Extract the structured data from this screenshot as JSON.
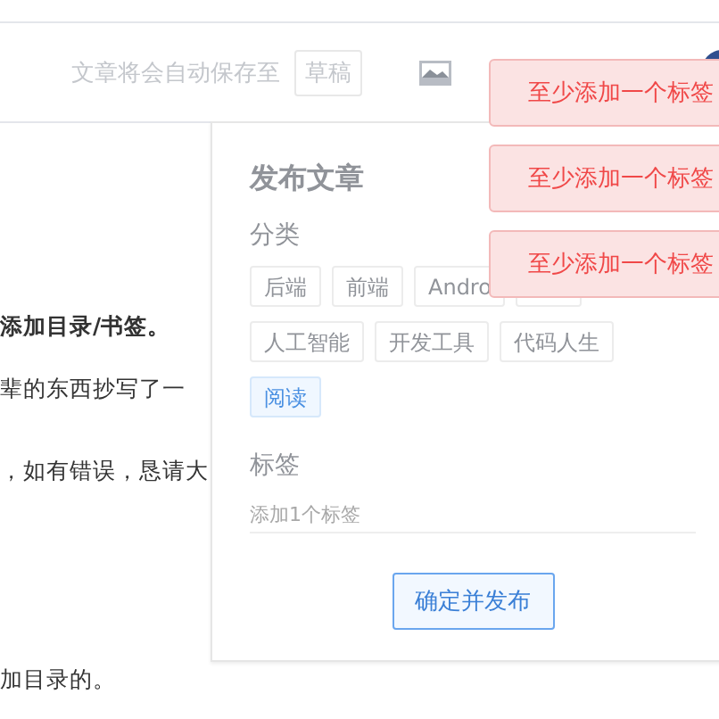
{
  "header": {
    "autosave_note": "文章将会自动保存至",
    "draft_button": "草稿"
  },
  "article": {
    "paragraphs": [
      {
        "text": "添加目录/书签。",
        "kind": "bold"
      },
      {
        "text": "辈的东西抄写了一",
        "kind": "plain"
      },
      {
        "text": "，如有错误，恳请大",
        "kind": "plain"
      },
      {
        "text": "加目录的。",
        "kind": "plain"
      }
    ]
  },
  "publish_panel": {
    "title": "发布文章",
    "category_label": "分类",
    "categories": [
      {
        "label": "后端",
        "selected": false
      },
      {
        "label": "前端",
        "selected": false
      },
      {
        "label": "Andro",
        "selected": false
      },
      {
        "selected": false
      },
      {
        "label": "人工智能",
        "selected": false
      },
      {
        "label": "开发工具",
        "selected": false
      },
      {
        "label": "代码人生",
        "selected": false
      },
      {
        "label": "阅读",
        "selected": true
      }
    ],
    "tag_label": "标签",
    "tag_input": {
      "placeholder": "添加1个标签"
    },
    "submit_button": "确定并发布"
  },
  "toasts": [
    {
      "message": "至少添加一个标签"
    },
    {
      "message": "至少添加一个标签"
    },
    {
      "message": "至少添加一个标签"
    }
  ]
}
